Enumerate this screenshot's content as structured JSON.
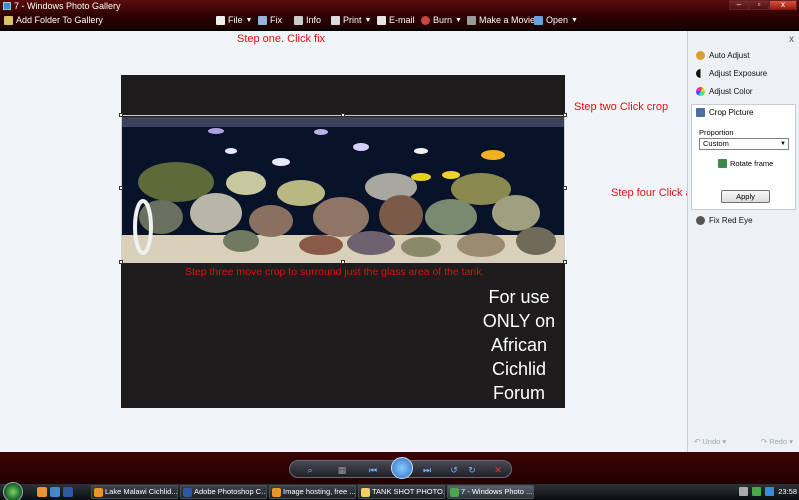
{
  "window": {
    "title": "7 - Windows Photo Gallery",
    "minimize_label": "–",
    "maximize_label": "▫",
    "close_label": "x"
  },
  "toolbar": {
    "add_folder": "Add Folder To Gallery",
    "file": "File",
    "fix": "Fix",
    "info": "Info",
    "print": "Print",
    "email": "E-mail",
    "burn": "Burn",
    "make_movie": "Make a Movie",
    "open": "Open"
  },
  "annotations": {
    "step1": "Step one. Click fix",
    "step2": "Step two Click crop",
    "step3": "Step three move crop to surround just the glass area of the tank.",
    "step4": "Step four Click apply"
  },
  "photo": {
    "watermark_lines": [
      "For use",
      "ONLY on",
      "African",
      "Cichlid",
      "Forum"
    ]
  },
  "fix_pane": {
    "close": "x",
    "auto_adjust": "Auto Adjust",
    "adjust_exposure": "Adjust Exposure",
    "adjust_color": "Adjust Color",
    "crop_picture": "Crop Picture",
    "proportion_label": "Proportion",
    "proportion_value": "Custom",
    "rotate_frame": "Rotate frame",
    "apply": "Apply",
    "fix_red_eye": "Fix Red Eye",
    "undo": "Undo",
    "redo": "Redo"
  },
  "controls": {
    "zoom": "⌕",
    "actual_size": "▦",
    "previous": "⏮",
    "next": "⏭",
    "rotate_ccw": "↺",
    "rotate_cw": "↻",
    "delete": "✕"
  },
  "taskbar": {
    "tasks": [
      {
        "label": "Lake Malawi Cichlid...",
        "color": "#e8952a"
      },
      {
        "label": "Adobe Photoshop C...",
        "color": "#2c5aa0"
      },
      {
        "label": "Image hosting, free ...",
        "color": "#e8952a"
      },
      {
        "label": "TANK SHOT PHOTO...",
        "color": "#f0d060"
      },
      {
        "label": "7 - Windows Photo ...",
        "color": "#4aa84a"
      }
    ],
    "clock": "23:58",
    "quick_launch_colors": [
      "#e8952a",
      "#3d8bd6",
      "#2c5aa0"
    ],
    "tray_colors": [
      "#aaa",
      "#4aa84a",
      "#3d8bd6"
    ]
  },
  "colors": {
    "annotation": "#e01010",
    "accent": "#3d8bd6"
  }
}
